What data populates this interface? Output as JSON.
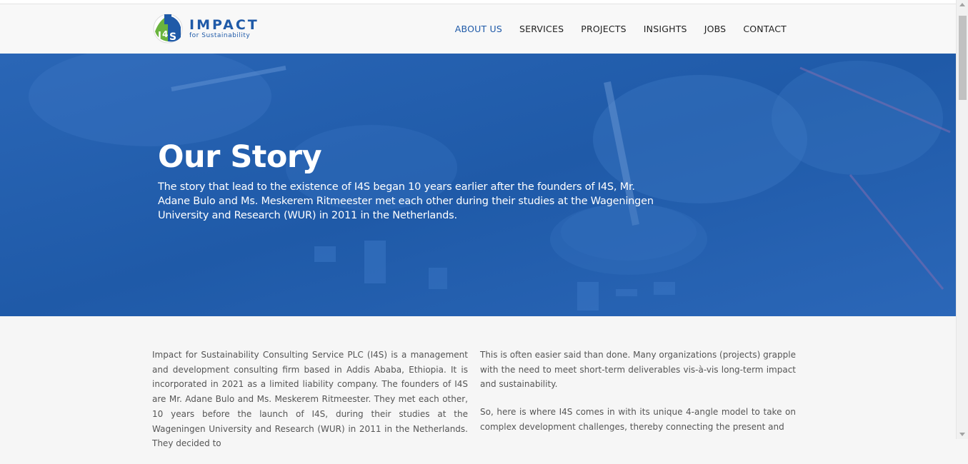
{
  "logo": {
    "title": "IMPACT",
    "subtitle": "for Sustainability",
    "mark_text": "I4S"
  },
  "nav": {
    "items": [
      {
        "label": "ABOUT US",
        "active": true
      },
      {
        "label": "SERVICES",
        "active": false
      },
      {
        "label": "PROJECTS",
        "active": false
      },
      {
        "label": "INSIGHTS",
        "active": false
      },
      {
        "label": "JOBS",
        "active": false
      },
      {
        "label": "CONTACT",
        "active": false
      }
    ]
  },
  "hero": {
    "title": "Our Story",
    "text": "The story that lead to the existence of I4S began 10 years earlier after the founders of I4S, Mr. Adane Bulo and Ms. Meskerem Ritmeester met each other during their studies at the Wageningen University and Research (WUR) in 2011 in the Netherlands."
  },
  "content": {
    "left_paragraph": "Impact for Sustainability Consulting Service PLC (I4S) is a management and development consulting firm based in Addis Ababa, Ethiopia. It is incorporated in 2021 as a limited liability company. The founders of I4S are Mr. Adane Bulo and Ms. Meskerem Ritmeester. They met each other, 10 years before the launch of I4S, during their studies at the Wageningen University and Research (WUR) in 2011 in the Netherlands. They decided to",
    "right_paragraph_1": "This is often easier said than done. Many organizations (projects) grapple with the need to meet short-term deliverables vis-à-vis long-term impact and sustainability.",
    "right_paragraph_2": "So, here is where I4S comes in with its unique 4-angle model to take on complex development challenges, thereby connecting the present and"
  },
  "colors": {
    "brand_blue": "#1f5aa8",
    "brand_green": "#6ab43e",
    "hero_blue": "#225eb0"
  }
}
